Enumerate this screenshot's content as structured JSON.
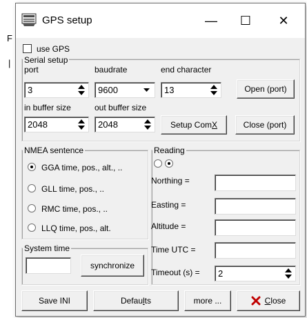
{
  "background": {
    "glyph_top": "F",
    "glyph_bottom": "|"
  },
  "window": {
    "title": "GPS setup",
    "minimize": "—",
    "maximize": "☐",
    "close": "✕"
  },
  "use_gps": {
    "label": "use GPS",
    "checked": false
  },
  "serial": {
    "legend": "Serial setup",
    "port_label": "port",
    "port_value": "3",
    "baud_label": "baudrate",
    "baud_value": "9600",
    "endchar_label": "end character",
    "endchar_value": "13",
    "open_btn": "Open (port)",
    "inbuf_label": "in buffer size",
    "inbuf_value": "2048",
    "outbuf_label": "out buffer size",
    "outbuf_value": "2048",
    "setup_btn_pre": "Setup Com",
    "setup_btn_acc": "X",
    "close_btn": "Close (port)"
  },
  "nmea": {
    "legend": "NMEA sentence",
    "options": [
      {
        "label": "GGA time, pos., alt., ..",
        "selected": true
      },
      {
        "label": "GLL time, pos., ..",
        "selected": false
      },
      {
        "label": "RMC time, pos., ..",
        "selected": false
      },
      {
        "label": "LLQ time, pos., alt.",
        "selected": false
      }
    ]
  },
  "reading": {
    "legend": "Reading",
    "northing_label": "Northing =",
    "easting_label": "Easting =",
    "altitude_label": "Altitude =",
    "time_label": "Time UTC =",
    "timeout_label": "Timeout (s) =",
    "timeout_value": "2"
  },
  "system_time": {
    "legend": "System time",
    "sync_btn": "synchronize"
  },
  "footer": {
    "save_btn": "Save INI",
    "defaults_pre": "Defau",
    "defaults_acc": "l",
    "defaults_post": "ts",
    "more_btn": "more ...",
    "close_pre": "",
    "close_acc": "C",
    "close_post": "lose"
  },
  "colors": {
    "close_x": "#c00000"
  }
}
